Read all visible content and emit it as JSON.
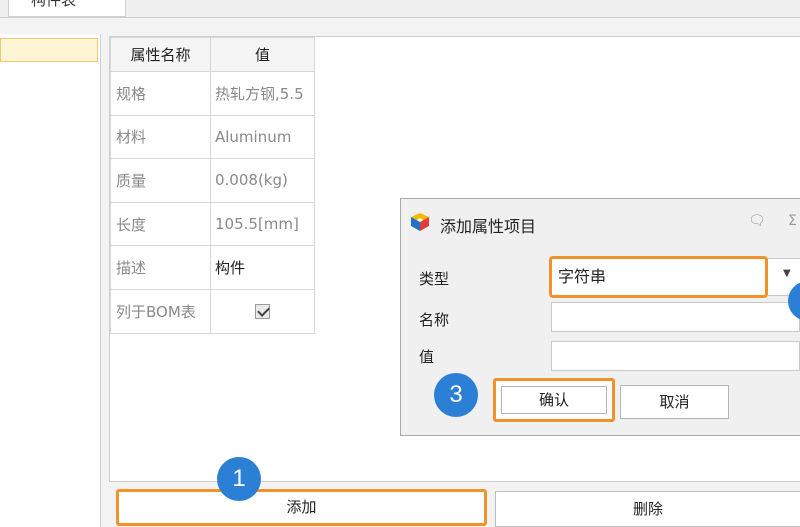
{
  "top_tab": {
    "label": "构件表"
  },
  "property_table": {
    "headers": [
      "属性名称",
      "值"
    ],
    "rows": [
      {
        "name": "规格",
        "value": "热轧方钢,5.5"
      },
      {
        "name": "材料",
        "value": "Aluminum"
      },
      {
        "name": "质量",
        "value": "0.008(kg)"
      },
      {
        "name": "长度",
        "value": "105.5[mm]"
      },
      {
        "name": "描述",
        "value": "构件"
      },
      {
        "name": "列于BOM表",
        "checked": true
      }
    ]
  },
  "buttons": {
    "add": "添加",
    "delete": "删除"
  },
  "dialog": {
    "title": "添加属性项目",
    "fields": {
      "type_label": "类型",
      "type_value": "字符串",
      "name_label": "名称",
      "name_value": "",
      "value_label": "值",
      "value_value": ""
    },
    "confirm": "确认",
    "cancel": "取消",
    "controls": {
      "restore": "🗨",
      "close": "Σ"
    }
  },
  "steps": {
    "one": "1",
    "three": "3"
  },
  "colors": {
    "highlight": "#f2922b",
    "step": "#2b7fd4",
    "selection": "#fdf5d3"
  }
}
